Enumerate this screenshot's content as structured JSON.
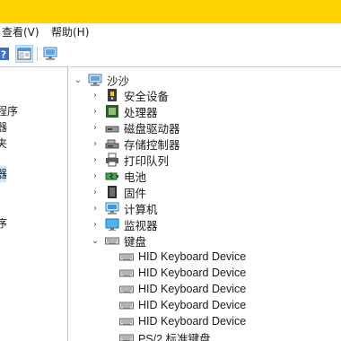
{
  "menu": [
    "查看(V)",
    "帮助(H)"
  ],
  "left_pane_items": [
    "程序",
    "器",
    "夹",
    "器",
    "序"
  ],
  "tree": {
    "root": "沙沙",
    "categories": [
      {
        "label": "安全设备",
        "icon": "security-device-icon"
      },
      {
        "label": "处理器",
        "icon": "processor-icon"
      },
      {
        "label": "磁盘驱动器",
        "icon": "disk-drive-icon"
      },
      {
        "label": "存储控制器",
        "icon": "storage-controller-icon"
      },
      {
        "label": "打印队列",
        "icon": "printer-icon"
      },
      {
        "label": "电池",
        "icon": "battery-icon"
      },
      {
        "label": "固件",
        "icon": "firmware-icon"
      },
      {
        "label": "计算机",
        "icon": "computer-icon"
      },
      {
        "label": "监视器",
        "icon": "monitor-icon"
      },
      {
        "label": "键盘",
        "icon": "keyboard-icon"
      }
    ],
    "keyboard_devices": [
      "HID Keyboard Device",
      "HID Keyboard Device",
      "HID Keyboard Device",
      "HID Keyboard Device",
      "HID Keyboard Device",
      "PS/2 标准键盘"
    ]
  },
  "colors": {
    "titlebar": "#ffd400",
    "selection": "#cce8ff"
  }
}
